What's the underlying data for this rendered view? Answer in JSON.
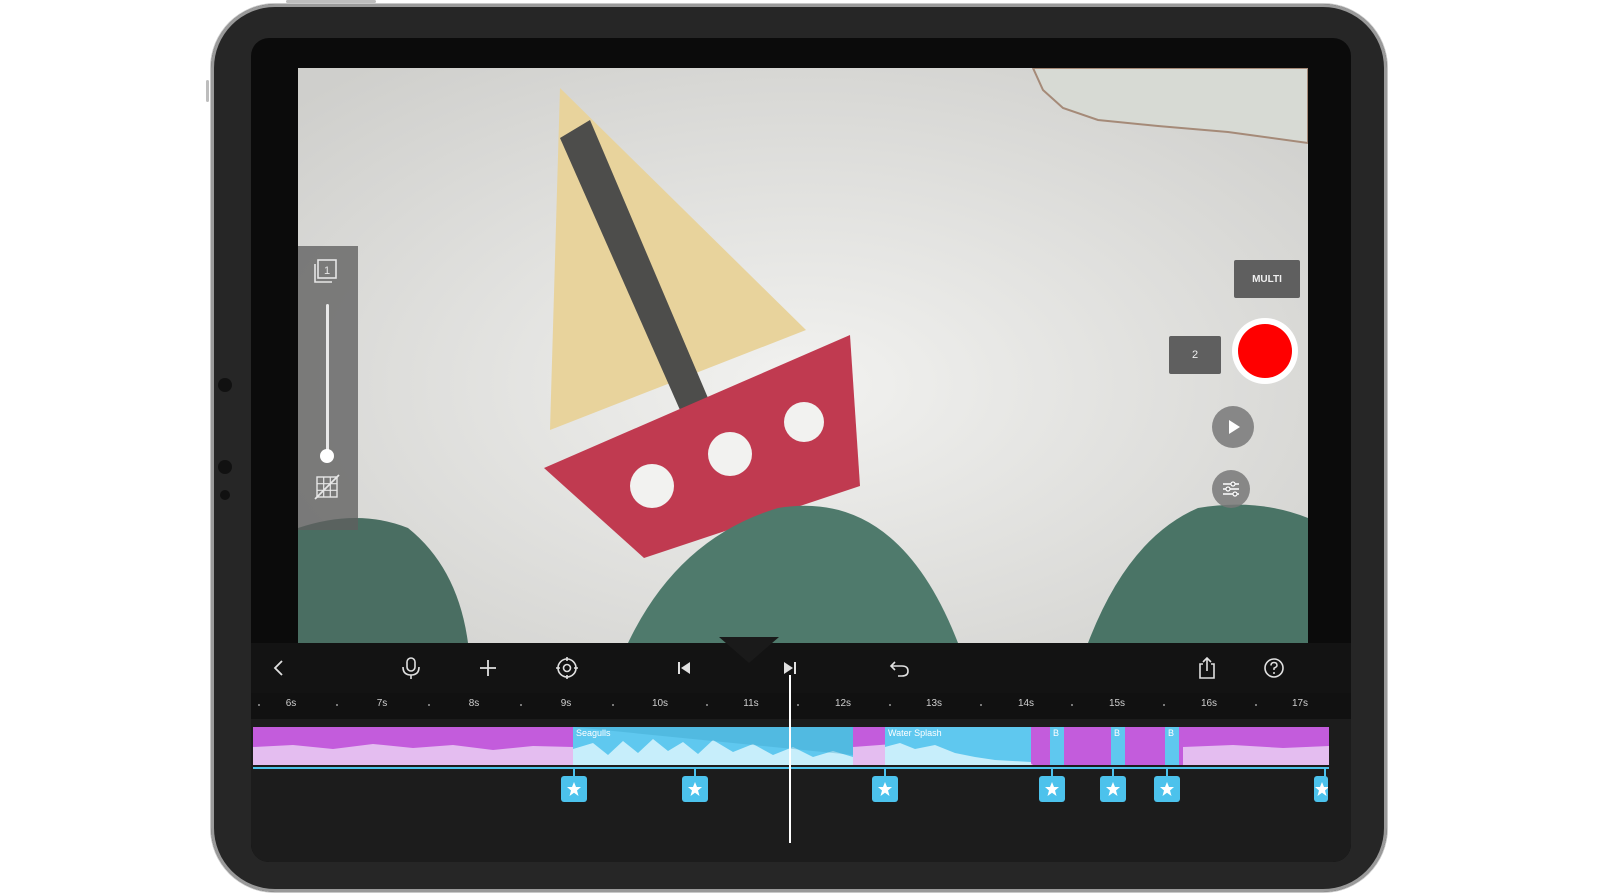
{
  "controls": {
    "multi_label": "MULTI",
    "frame_count": "2"
  },
  "toolbar": {
    "icons": [
      "back-icon",
      "microphone-icon",
      "add-icon",
      "settings-icon",
      "skip-back-icon",
      "skip-forward-icon",
      "undo-icon",
      "share-icon",
      "help-icon"
    ]
  },
  "ruler": {
    "labels": [
      "6s",
      "7s",
      "8s",
      "9s",
      "10s",
      "11s",
      "12s",
      "13s",
      "14s",
      "15s",
      "16s",
      "17s"
    ]
  },
  "timeline": {
    "clips": [
      {
        "label": "Seagulls"
      },
      {
        "label": "Water Splash"
      },
      {
        "label": "B"
      },
      {
        "label": "B"
      },
      {
        "label": "B"
      }
    ]
  },
  "colors": {
    "audio_track": "#c35cdc",
    "sound_clip": "#5fc8ef",
    "record": "#ff0000"
  }
}
